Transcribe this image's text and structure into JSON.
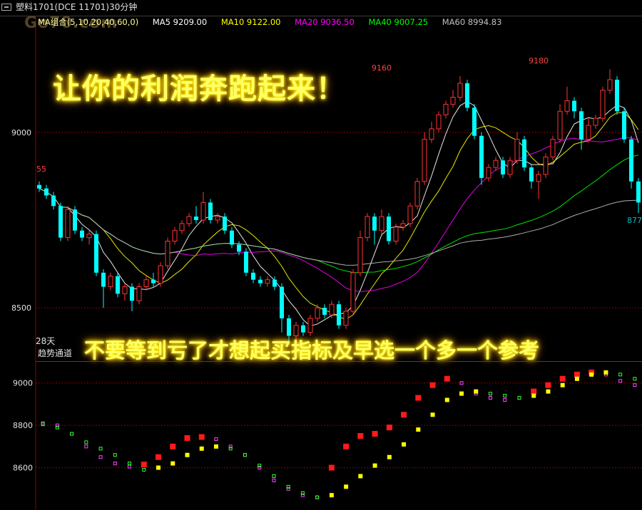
{
  "window": {
    "title": "塑料1701(DCE 11701)30分钟",
    "watermark": "Go70.com"
  },
  "ma_legend": [
    {
      "text": "MA组合(5,10,20,40,60,0)",
      "color": "#ffff99"
    },
    {
      "text": "MA5 9209.00",
      "color": "#ffffff"
    },
    {
      "text": "MA10 9122.00",
      "color": "#ffff00"
    },
    {
      "text": "MA20 9036.50",
      "color": "#ff00ff"
    },
    {
      "text": "MA40 9007.25",
      "color": "#00ff00"
    },
    {
      "text": "MA60 8994.83",
      "color": "#c0c0c0"
    }
  ],
  "promo": {
    "top": "让你的利润奔跑起来！",
    "bottom": "不要等到亏了才想起买指标及早选一个多一个参考"
  },
  "lower_panel": {
    "days_label": "28天",
    "channel_label": "趋势通道"
  },
  "colors": {
    "up": "#ff3333",
    "down": "#00ffff",
    "grid": "#8b0000",
    "axis_text": "#e0e0e0",
    "annotation": "#ff4040",
    "annotation_low": "#00c0c0"
  },
  "chart_data": {
    "type": "candlestick",
    "main": {
      "y_ticks": [
        9000,
        8500
      ],
      "ylim": [
        8350,
        9300
      ],
      "annotations": [
        {
          "label": "55",
          "price": 8855,
          "index": 0
        },
        {
          "label": "9160",
          "price": 9160,
          "index": 48
        },
        {
          "label": "9180",
          "price": 9180,
          "index": 70
        },
        {
          "label": "877",
          "price": 8770,
          "index": 83
        }
      ],
      "candles": [
        [
          8850,
          8840,
          8860,
          8830
        ],
        [
          8840,
          8820,
          8850,
          8810
        ],
        [
          8820,
          8790,
          8830,
          8780
        ],
        [
          8790,
          8700,
          8800,
          8690
        ],
        [
          8700,
          8780,
          8790,
          8690
        ],
        [
          8780,
          8720,
          8790,
          8710
        ],
        [
          8720,
          8700,
          8730,
          8690
        ],
        [
          8700,
          8710,
          8720,
          8680
        ],
        [
          8710,
          8600,
          8720,
          8590
        ],
        [
          8600,
          8560,
          8610,
          8500
        ],
        [
          8560,
          8590,
          8600,
          8550
        ],
        [
          8590,
          8540,
          8600,
          8530
        ],
        [
          8540,
          8560,
          8570,
          8520
        ],
        [
          8560,
          8520,
          8570,
          8490
        ],
        [
          8520,
          8560,
          8570,
          8510
        ],
        [
          8560,
          8580,
          8590,
          8550
        ],
        [
          8580,
          8570,
          8600,
          8560
        ],
        [
          8570,
          8620,
          8630,
          8560
        ],
        [
          8620,
          8690,
          8700,
          8610
        ],
        [
          8690,
          8720,
          8730,
          8680
        ],
        [
          8720,
          8740,
          8750,
          8710
        ],
        [
          8740,
          8760,
          8770,
          8730
        ],
        [
          8760,
          8750,
          8790,
          8740
        ],
        [
          8750,
          8800,
          8830,
          8740
        ],
        [
          8800,
          8750,
          8810,
          8740
        ],
        [
          8750,
          8760,
          8770,
          8740
        ],
        [
          8760,
          8720,
          8770,
          8710
        ],
        [
          8720,
          8680,
          8730,
          8670
        ],
        [
          8680,
          8660,
          8690,
          8650
        ],
        [
          8660,
          8600,
          8670,
          8590
        ],
        [
          8600,
          8580,
          8610,
          8570
        ],
        [
          8580,
          8570,
          8590,
          8560
        ],
        [
          8570,
          8580,
          8590,
          8560
        ],
        [
          8580,
          8560,
          8590,
          8550
        ],
        [
          8560,
          8470,
          8570,
          8430
        ],
        [
          8470,
          8420,
          8480,
          8400
        ],
        [
          8420,
          8450,
          8460,
          8400
        ],
        [
          8450,
          8430,
          8460,
          8420
        ],
        [
          8430,
          8470,
          8480,
          8420
        ],
        [
          8470,
          8500,
          8510,
          8460
        ],
        [
          8500,
          8480,
          8510,
          8470
        ],
        [
          8480,
          8510,
          8520,
          8470
        ],
        [
          8510,
          8450,
          8520,
          8440
        ],
        [
          8450,
          8490,
          8500,
          8440
        ],
        [
          8490,
          8600,
          8610,
          8480
        ],
        [
          8600,
          8700,
          8720,
          8590
        ],
        [
          8700,
          8760,
          8770,
          8690
        ],
        [
          8760,
          8720,
          8770,
          8680
        ],
        [
          8720,
          8760,
          8780,
          8710
        ],
        [
          8760,
          8690,
          8770,
          8680
        ],
        [
          8690,
          8730,
          8740,
          8680
        ],
        [
          8730,
          8740,
          8750,
          8720
        ],
        [
          8740,
          8790,
          8800,
          8730
        ],
        [
          8790,
          8860,
          8870,
          8780
        ],
        [
          8860,
          8980,
          9000,
          8850
        ],
        [
          8980,
          9010,
          9030,
          8970
        ],
        [
          9010,
          9050,
          9060,
          9000
        ],
        [
          9050,
          9080,
          9090,
          9040
        ],
        [
          9080,
          9100,
          9120,
          9070
        ],
        [
          9100,
          9140,
          9160,
          9090
        ],
        [
          9140,
          9070,
          9150,
          9060
        ],
        [
          9070,
          8990,
          9080,
          8980
        ],
        [
          8990,
          8870,
          9000,
          8850
        ],
        [
          8870,
          8900,
          8910,
          8860
        ],
        [
          8900,
          8920,
          8930,
          8890
        ],
        [
          8920,
          8880,
          8930,
          8870
        ],
        [
          8880,
          8920,
          8930,
          8870
        ],
        [
          8920,
          8980,
          9000,
          8910
        ],
        [
          8980,
          8900,
          8990,
          8890
        ],
        [
          8900,
          8860,
          8910,
          8840
        ],
        [
          8860,
          8880,
          8890,
          8810
        ],
        [
          8880,
          8930,
          8940,
          8870
        ],
        [
          8930,
          8980,
          8990,
          8920
        ],
        [
          8980,
          9060,
          9080,
          8970
        ],
        [
          9060,
          9090,
          9130,
          9050
        ],
        [
          9090,
          9060,
          9100,
          9040
        ],
        [
          9060,
          8980,
          9070,
          8950
        ],
        [
          8980,
          9020,
          9040,
          8970
        ],
        [
          9020,
          9040,
          9050,
          9010
        ],
        [
          9040,
          9120,
          9130,
          9030
        ],
        [
          9120,
          9150,
          9180,
          9110
        ],
        [
          9150,
          9060,
          9160,
          9050
        ],
        [
          9060,
          8980,
          9070,
          8970
        ],
        [
          8980,
          8860,
          8990,
          8840
        ],
        [
          8860,
          8800,
          8870,
          8770
        ]
      ]
    },
    "lower": {
      "y_ticks": [
        9000,
        8800,
        8600
      ],
      "ylim": [
        8400,
        9100
      ],
      "series": [
        {
          "name": "upper",
          "values": [
            8810,
            8800,
            8760,
            8700,
            8650,
            8620,
            8605,
            8615,
            8650,
            8700,
            8740,
            8745,
            8735,
            8700,
            8660,
            8600,
            8540,
            8500,
            8470,
            8460,
            8600,
            8700,
            8750,
            8760,
            8790,
            8850,
            8930,
            8990,
            9020,
            9000,
            8950,
            8930,
            8920,
            8930,
            8960,
            8990,
            9020,
            9040,
            9050,
            9040,
            9010,
            8990
          ]
        },
        {
          "name": "lower",
          "values": [
            8805,
            8790,
            8760,
            8720,
            8690,
            8660,
            8620,
            8590,
            8600,
            8620,
            8660,
            8690,
            8700,
            8690,
            8660,
            8610,
            8560,
            8510,
            8480,
            8460,
            8470,
            8510,
            8560,
            8610,
            8650,
            8710,
            8780,
            8850,
            8920,
            8950,
            8960,
            8950,
            8940,
            8930,
            8940,
            8960,
            8990,
            9020,
            9040,
            9050,
            9040,
            9020
          ]
        }
      ]
    }
  }
}
